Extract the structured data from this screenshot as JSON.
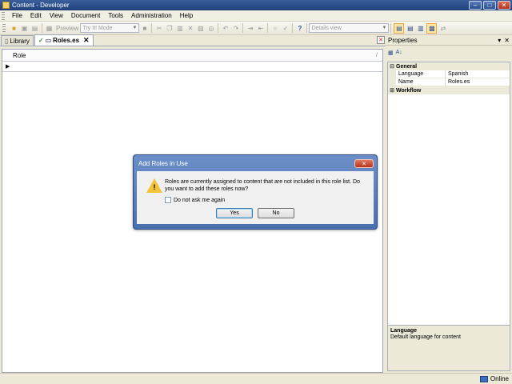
{
  "window": {
    "title": "Content - Developer"
  },
  "menubar": {
    "items": [
      "File",
      "Edit",
      "View",
      "Document",
      "Tools",
      "Administration",
      "Help"
    ]
  },
  "toolbar": {
    "preview_label": "Preview",
    "mode_combo_value": "Try It! Mode",
    "view_combo_value": "Details view"
  },
  "document": {
    "tabs": [
      {
        "label": "Library",
        "icon": "library-icon"
      },
      {
        "label": "Roles.es",
        "icon": "check-icon",
        "active": true
      }
    ],
    "grid": {
      "column_header": "Role"
    }
  },
  "properties": {
    "title": "Properties",
    "categories": [
      {
        "name": "General",
        "expanded": true,
        "rows": [
          {
            "name": "Language",
            "value": "Spanish"
          },
          {
            "name": "Name",
            "value": "Roles.es"
          }
        ]
      },
      {
        "name": "Workflow",
        "expanded": false
      }
    ],
    "description": {
      "title": "Language",
      "text": "Default language for content"
    }
  },
  "dialog": {
    "title": "Add Roles in Use",
    "message": "Roles are currently assigned to content that are not included in this role list. Do you want to add these roles now?",
    "checkbox_label": "Do not ask me again",
    "checkbox_checked": false,
    "yes_label": "Yes",
    "no_label": "No"
  },
  "status": {
    "connection": "Online"
  }
}
